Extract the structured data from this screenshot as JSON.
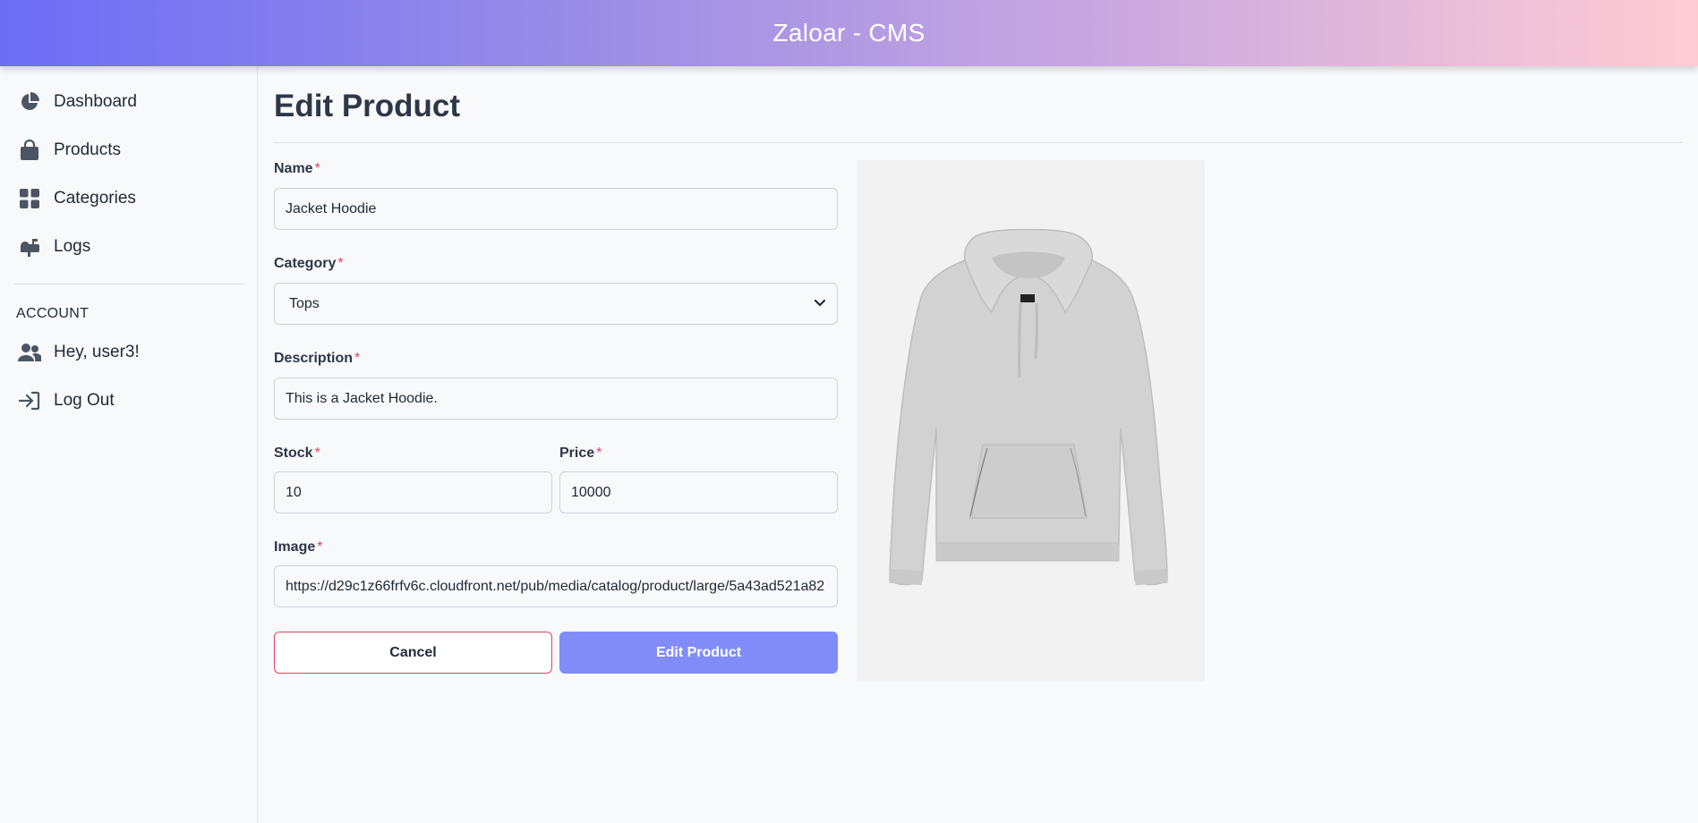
{
  "header": {
    "title": "Zaloar - CMS"
  },
  "sidebar": {
    "items": [
      {
        "label": "Dashboard",
        "icon": "pie-chart-icon"
      },
      {
        "label": "Products",
        "icon": "shopping-bag-icon"
      },
      {
        "label": "Categories",
        "icon": "grid-icon"
      },
      {
        "label": "Logs",
        "icon": "mailbox-icon"
      }
    ],
    "account_title": "ACCOUNT",
    "account_items": [
      {
        "label": "Hey, user3!",
        "icon": "users-icon"
      },
      {
        "label": "Log Out",
        "icon": "sign-in-arrow-icon"
      }
    ]
  },
  "page": {
    "title": "Edit Product"
  },
  "form": {
    "required_mark": "*",
    "name": {
      "label": "Name",
      "value": "Jacket Hoodie"
    },
    "category": {
      "label": "Category",
      "value": "Tops"
    },
    "description": {
      "label": "Description",
      "value": "This is a Jacket Hoodie."
    },
    "stock": {
      "label": "Stock",
      "value": "10"
    },
    "price": {
      "label": "Price",
      "value": "10000"
    },
    "image": {
      "label": "Image",
      "value": "https://d29c1z66frfv6c.cloudfront.net/pub/media/catalog/product/large/5a43ad521a82"
    },
    "cancel_label": "Cancel",
    "submit_label": "Edit Product"
  },
  "colors": {
    "header_gradient_start": "#6d6df6",
    "header_gradient_end": "#ffccd3",
    "primary_button": "#818cf8",
    "required_mark": "#e0435c",
    "icon": "#4b5563"
  }
}
